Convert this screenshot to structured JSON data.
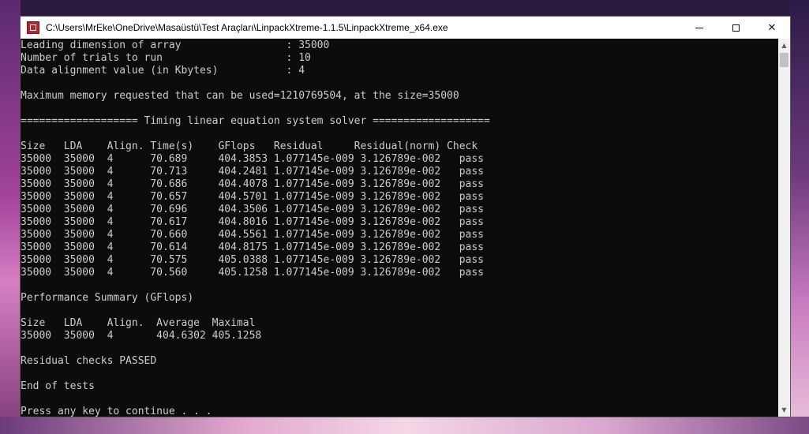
{
  "window": {
    "title": "C:\\Users\\MrEke\\OneDrive\\Masaüstü\\Test Araçları\\LinpackXtreme-1.1.5\\LinpackXtreme_x64.exe",
    "controls": {
      "minimize": "minimize-icon",
      "maximize": "maximize-icon",
      "close": "✕"
    }
  },
  "colors": {
    "console_bg": "#0c0c0c",
    "console_fg": "#cccccc",
    "titlebar_bg": "#ffffff"
  },
  "console": {
    "lines": [
      "Leading dimension of array                 : 35000",
      "Number of trials to run                    : 10",
      "Data alignment value (in Kbytes)           : 4",
      "",
      "Maximum memory requested that can be used=1210769504, at the size=35000",
      "",
      "=================== Timing linear equation system solver ===================",
      "",
      "Size   LDA    Align. Time(s)    GFlops   Residual     Residual(norm) Check",
      "35000  35000  4      70.689     404.3853 1.077145e-009 3.126789e-002   pass",
      "35000  35000  4      70.713     404.2481 1.077145e-009 3.126789e-002   pass",
      "35000  35000  4      70.686     404.4078 1.077145e-009 3.126789e-002   pass",
      "35000  35000  4      70.657     404.5701 1.077145e-009 3.126789e-002   pass",
      "35000  35000  4      70.696     404.3506 1.077145e-009 3.126789e-002   pass",
      "35000  35000  4      70.617     404.8016 1.077145e-009 3.126789e-002   pass",
      "35000  35000  4      70.660     404.5561 1.077145e-009 3.126789e-002   pass",
      "35000  35000  4      70.614     404.8175 1.077145e-009 3.126789e-002   pass",
      "35000  35000  4      70.575     405.0388 1.077145e-009 3.126789e-002   pass",
      "35000  35000  4      70.560     405.1258 1.077145e-009 3.126789e-002   pass",
      "",
      "Performance Summary (GFlops)",
      "",
      "Size   LDA    Align.  Average  Maximal",
      "35000  35000  4       404.6302 405.1258",
      "",
      "Residual checks PASSED",
      "",
      "End of tests",
      "",
      "Press any key to continue . . ."
    ]
  },
  "scrollbar": {
    "up_arrow": "▲",
    "down_arrow": "▼"
  }
}
